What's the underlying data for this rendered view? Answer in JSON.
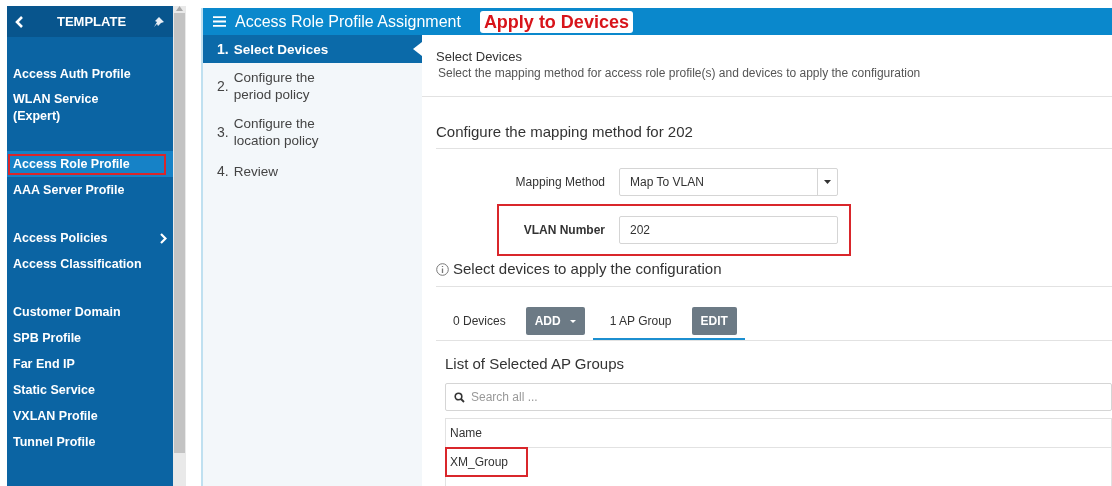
{
  "sidebar": {
    "title": "TEMPLATE",
    "groups": [
      [
        {
          "label": "Access Auth Profile",
          "selected": false,
          "annotated": false,
          "has_submenu": false
        },
        {
          "label": "WLAN Service (Expert)",
          "selected": false,
          "annotated": false,
          "has_submenu": false
        }
      ],
      [
        {
          "label": "Access Role Profile",
          "selected": true,
          "annotated": true,
          "has_submenu": false
        },
        {
          "label": "AAA Server Profile",
          "selected": false,
          "annotated": false,
          "has_submenu": false
        }
      ],
      [
        {
          "label": "Access Policies",
          "selected": false,
          "annotated": false,
          "has_submenu": true
        },
        {
          "label": "Access Classification",
          "selected": false,
          "annotated": false,
          "has_submenu": false
        }
      ],
      [
        {
          "label": "Customer Domain",
          "selected": false,
          "annotated": false,
          "has_submenu": false
        },
        {
          "label": "SPB Profile",
          "selected": false,
          "annotated": false,
          "has_submenu": false
        },
        {
          "label": "Far End IP",
          "selected": false,
          "annotated": false,
          "has_submenu": false
        },
        {
          "label": "Static Service",
          "selected": false,
          "annotated": false,
          "has_submenu": false
        },
        {
          "label": "VXLAN Profile",
          "selected": false,
          "annotated": false,
          "has_submenu": false
        },
        {
          "label": "Tunnel Profile",
          "selected": false,
          "annotated": false,
          "has_submenu": false
        }
      ]
    ]
  },
  "header": {
    "title": "Access Role Profile Assignment",
    "annotation": "Apply to Devices"
  },
  "steps": [
    {
      "number": "1.",
      "label": "Select Devices",
      "selected": true
    },
    {
      "number": "2.",
      "label": "Configure the period policy",
      "selected": false
    },
    {
      "number": "3.",
      "label": "Configure the location policy",
      "selected": false
    },
    {
      "number": "4.",
      "label": "Review",
      "selected": false
    }
  ],
  "content": {
    "title": "Select Devices",
    "subtitle": "Select the mapping method for access role profile(s) and devices to apply the configuration",
    "section_title": "Configure the mapping method for 202",
    "fields": [
      {
        "kind": "select",
        "label": "Mapping Method",
        "value": "Map To VLAN",
        "annotated": false
      },
      {
        "kind": "input",
        "label": "VLAN Number",
        "value": "202",
        "annotated": true
      }
    ],
    "devices_title": "Select devices to apply the configuration",
    "tabs": [
      {
        "label": "0 Devices",
        "selected": false,
        "button": "ADD",
        "dropdown": true
      },
      {
        "label": "1 AP Group",
        "selected": true,
        "button": "EDIT",
        "dropdown": false
      }
    ],
    "list_title": "List of Selected AP Groups",
    "search": {
      "placeholder": "Search all ..."
    },
    "table": {
      "columns": [
        "Name"
      ],
      "rows": [
        {
          "cells": [
            "XM_Group"
          ],
          "annotated": true
        }
      ]
    }
  }
}
